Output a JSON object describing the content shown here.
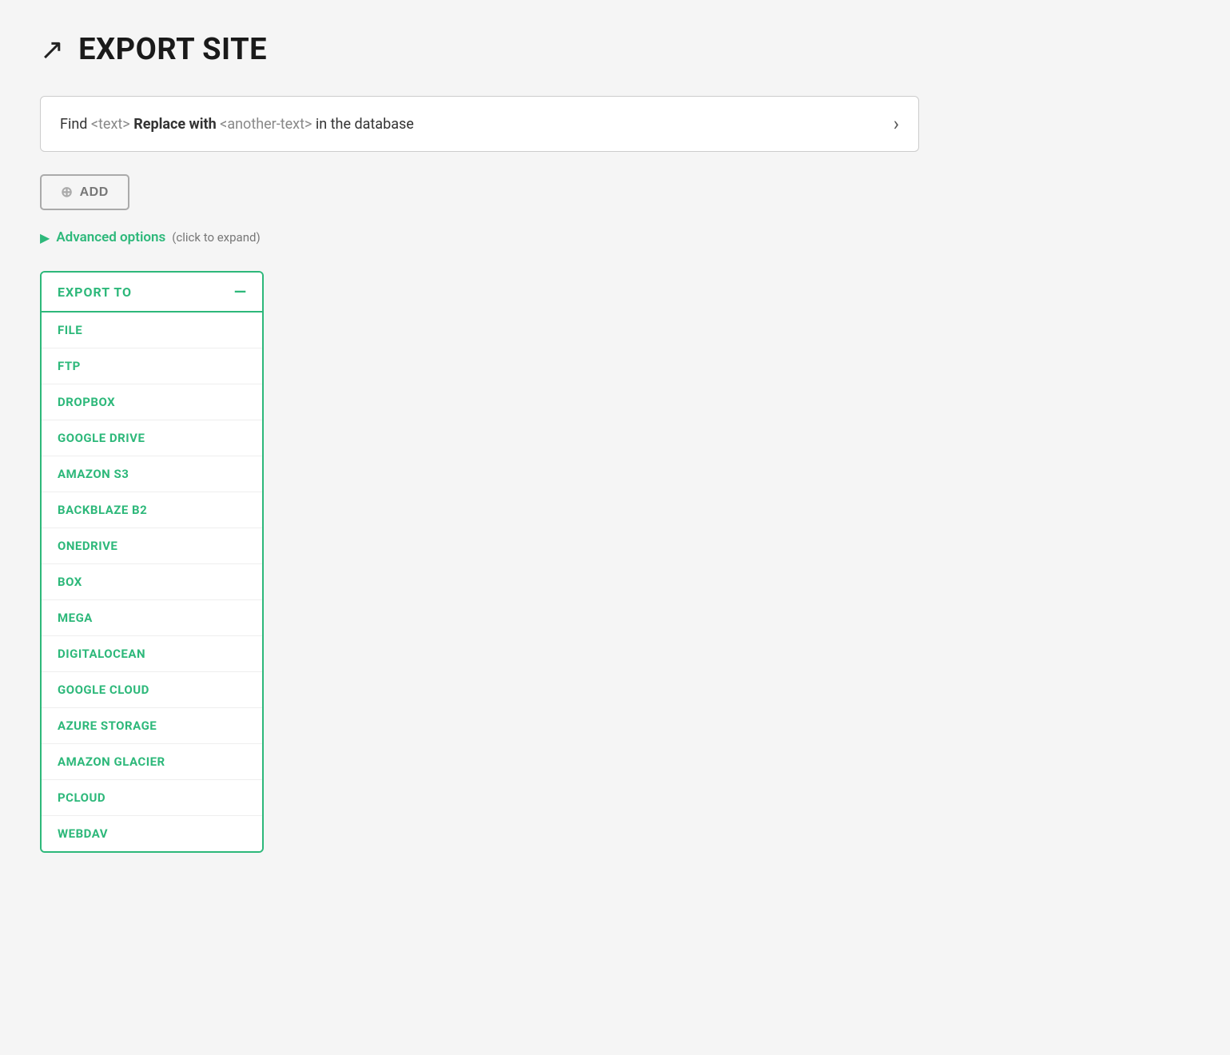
{
  "header": {
    "icon": "↗",
    "title": "EXPORT SITE"
  },
  "find_replace_bar": {
    "prefix": "Find",
    "tag1": "<text>",
    "action": "Replace with",
    "tag2": "<another-text>",
    "suffix": "in the database",
    "arrow": "›"
  },
  "add_button": {
    "label": "ADD",
    "plus_icon": "⊕"
  },
  "advanced_options": {
    "arrow": "▶",
    "label": "Advanced options",
    "hint": "(click to expand)"
  },
  "export_panel": {
    "title": "EXPORT TO",
    "minus_icon": "—",
    "items": [
      {
        "label": "FILE"
      },
      {
        "label": "FTP"
      },
      {
        "label": "DROPBOX"
      },
      {
        "label": "GOOGLE DRIVE"
      },
      {
        "label": "AMAZON S3"
      },
      {
        "label": "BACKBLAZE B2"
      },
      {
        "label": "ONEDRIVE"
      },
      {
        "label": "BOX"
      },
      {
        "label": "MEGA"
      },
      {
        "label": "DIGITALOCEAN"
      },
      {
        "label": "GOOGLE CLOUD"
      },
      {
        "label": "AZURE STORAGE"
      },
      {
        "label": "AMAZON GLACIER"
      },
      {
        "label": "PCLOUD"
      },
      {
        "label": "WEBDAV"
      }
    ]
  }
}
